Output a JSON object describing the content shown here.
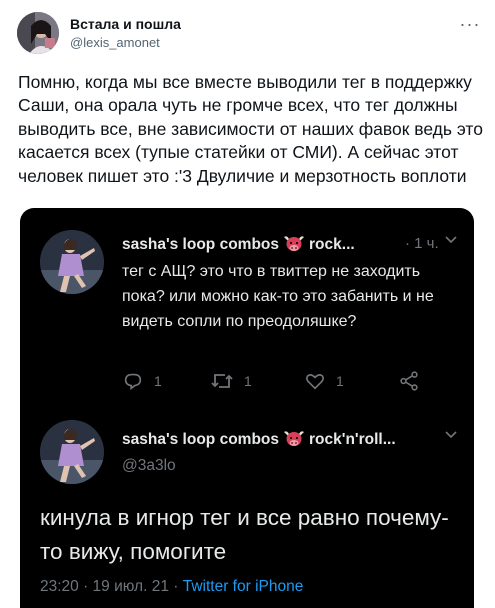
{
  "author": {
    "display_name": "Встала и пошла",
    "handle": "@lexis_amonet"
  },
  "more_icon": "more-horizontal-icon",
  "tweet_text": "Помню, когда мы все вместе выводили тег в поддержку Саши, она орала чуть не громче всех, что тег должны выводить все, вне зависимости от наших фавок ведь это касается всех (тупые статейки от СМИ). А сейчас этот человек пишет это :'3 Двуличие и мерзотность воплоти",
  "screenshot": {
    "reply": {
      "name_prefix": "sasha's loop combos",
      "name_suffix": "rock...",
      "time": "· 1 ч.",
      "text": "тег с АЩ? это что в твиттер не заходить пока? или можно как-то это забанить и не видеть сопли по преодоляшке?",
      "actions": [
        {
          "icon": "reply-icon",
          "count": "1"
        },
        {
          "icon": "retweet-icon",
          "count": "1"
        },
        {
          "icon": "like-icon",
          "count": "1"
        },
        {
          "icon": "share-icon",
          "count": ""
        }
      ]
    },
    "main": {
      "name_prefix": "sasha's loop combos",
      "name_suffix": "rock'n'roll...",
      "handle": "@3a3lo",
      "text": "кинула в игнор тег и все равно почему-то вижу, помогите",
      "timestamp": "23:20 · 19 июл. 21 · ",
      "source": "Twitter for iPhone"
    },
    "emoji": "bull-face-emoji"
  },
  "colors": {
    "accent": "#1d9bf0",
    "dark_bg": "#000000",
    "muted": "#71767b"
  }
}
